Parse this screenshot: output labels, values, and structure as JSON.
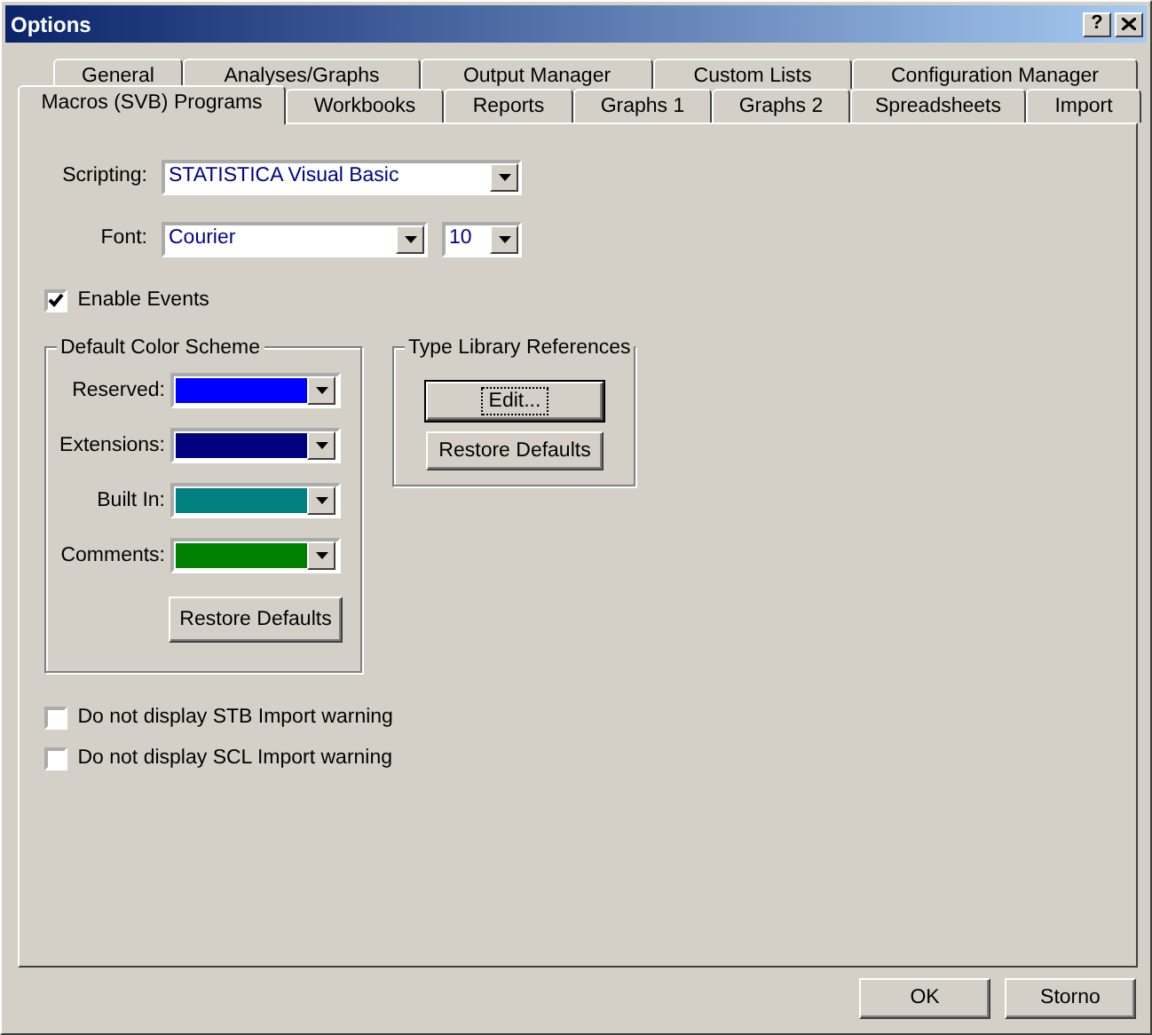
{
  "window": {
    "title": "Options",
    "buttons": [
      {
        "kind": "help",
        "label": "?"
      },
      {
        "kind": "close"
      }
    ]
  },
  "tab_rows": [
    [
      {
        "label": "General",
        "selected": false
      },
      {
        "label": "Analyses/Graphs",
        "selected": false
      },
      {
        "label": "Output Manager",
        "selected": false
      },
      {
        "label": "Custom Lists",
        "selected": false
      },
      {
        "label": "Configuration Manager",
        "selected": false
      }
    ],
    [
      {
        "label": "Macros (SVB) Programs",
        "selected": true
      },
      {
        "label": "Workbooks",
        "selected": false
      },
      {
        "label": "Reports",
        "selected": false
      },
      {
        "label": "Graphs 1",
        "selected": false
      },
      {
        "label": "Graphs 2",
        "selected": false
      },
      {
        "label": "Spreadsheets",
        "selected": false
      },
      {
        "label": "Import",
        "selected": false
      }
    ]
  ],
  "scripting": {
    "label": "Scripting:",
    "value": "STATISTICA Visual Basic"
  },
  "font": {
    "label": "Font:",
    "value": "Courier",
    "size": "10"
  },
  "enable_events": {
    "label": "Enable Events",
    "checked": true
  },
  "color_scheme": {
    "title": "Default Color Scheme",
    "items": [
      {
        "label": "Reserved:",
        "color": "#0000ff"
      },
      {
        "label": "Extensions:",
        "color": "#000080"
      },
      {
        "label": "Built In:",
        "color": "#008080"
      },
      {
        "label": "Comments:",
        "color": "#008000"
      }
    ],
    "button": "Restore Defaults"
  },
  "type_library": {
    "title": "Type Library References",
    "buttons": [
      {
        "label": "Edit...",
        "focused": true
      },
      {
        "label": "Restore Defaults",
        "focused": false
      }
    ]
  },
  "warnings": [
    {
      "label": "Do not display STB Import warning",
      "checked": false
    },
    {
      "label": "Do not display SCL Import warning",
      "checked": false
    }
  ],
  "footer_buttons": [
    "OK",
    "Storno"
  ]
}
